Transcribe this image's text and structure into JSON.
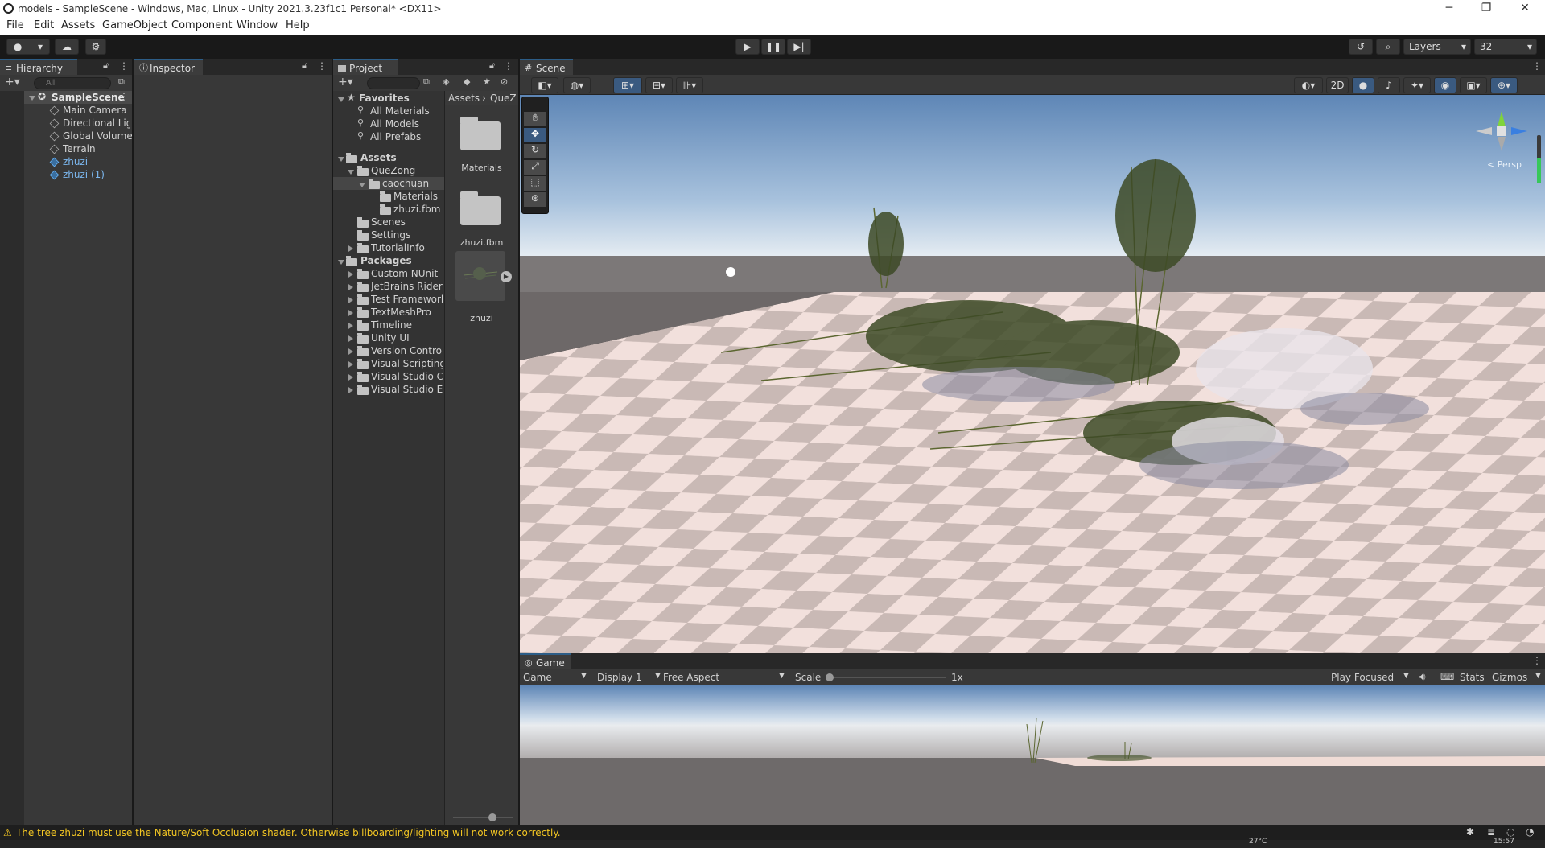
{
  "window": {
    "title": "models - SampleScene - Windows, Mac, Linux - Unity 2021.3.23f1c1 Personal* <DX11>"
  },
  "menu": [
    "File",
    "Edit",
    "Assets",
    "GameObject",
    "Component",
    "Window",
    "Help"
  ],
  "toolbar": {
    "layers_label": "Layers",
    "layout_label": "32",
    "account_label": "—"
  },
  "hierarchy": {
    "tab_label": "Hierarchy",
    "search_placeholder": "All",
    "scene_name": "SampleScene",
    "items": [
      "Main Camera",
      "Directional Ligh",
      "Global Volume",
      "Terrain",
      "zhuzi",
      "zhuzi (1)"
    ]
  },
  "inspector": {
    "tab_label": "Inspector"
  },
  "project": {
    "tab_label": "Project",
    "favorites_label": "Favorites",
    "favorites": [
      "All Materials",
      "All Models",
      "All Prefabs"
    ],
    "assets_label": "Assets",
    "queZong": "QueZong",
    "caochuan": "caochuan",
    "caochuan_children": [
      "Materials",
      "zhuzi.fbm"
    ],
    "assets_other": [
      "Scenes",
      "Settings",
      "TutorialInfo"
    ],
    "packages_label": "Packages",
    "packages": [
      "Custom NUnit",
      "JetBrains Rider I",
      "Test Framework",
      "TextMeshPro",
      "Timeline",
      "Unity UI",
      "Version Control",
      "Visual Scripting",
      "Visual Studio Co",
      "Visual Studio Ed"
    ],
    "breadcrumb_root": "Assets",
    "breadcrumb_child": "QueZ",
    "grid_items": [
      "Materials",
      "zhuzi.fbm",
      "zhuzi"
    ]
  },
  "scene": {
    "tab_label": "Scene",
    "mode_2d": "2D",
    "gizmo_persp": "< Persp"
  },
  "game": {
    "tab_label": "Game",
    "view_select": "Game",
    "display_select": "Display 1",
    "aspect_select": "Free Aspect",
    "scale_label": "Scale",
    "scale_value": "1x",
    "scale_fraction": 0.0,
    "play_focused": "Play Focused",
    "stats_label": "Stats",
    "gizmos_label": "Gizmos"
  },
  "status": {
    "message": "The tree zhuzi must use the Nature/Soft Occlusion shader. Otherwise billboarding/lighting will not work correctly.",
    "warning_color": "#f3c623"
  },
  "taskbar": {
    "temperature": "27°C",
    "time": "15:57"
  }
}
